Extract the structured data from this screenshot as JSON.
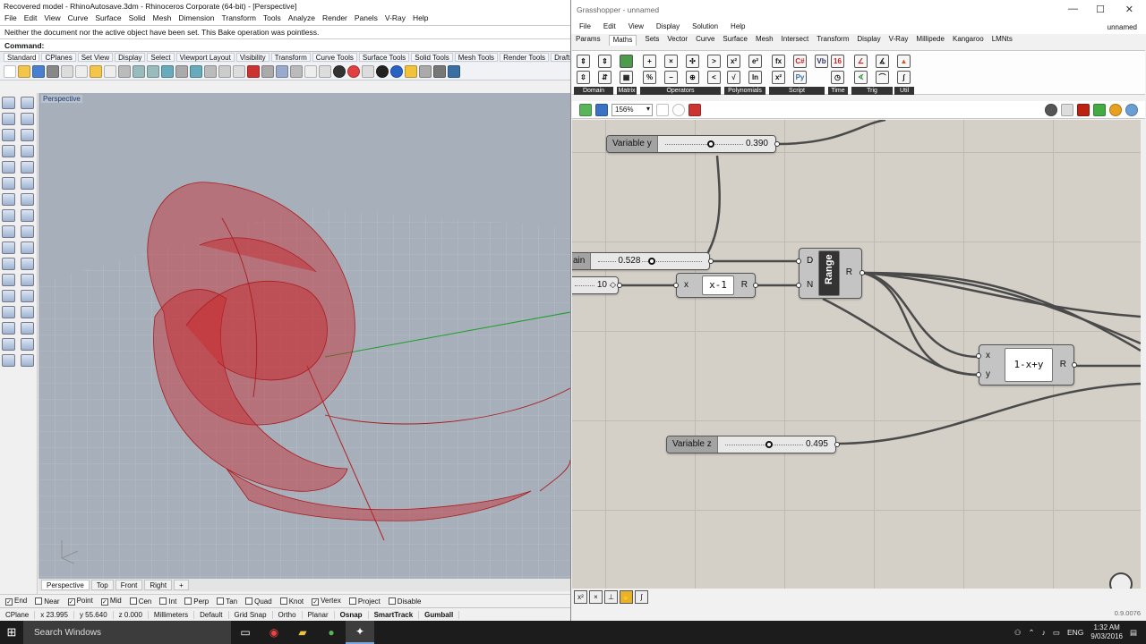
{
  "rhino": {
    "title": "Recovered model - RhinoAutosave.3dm - Rhinoceros Corporate (64-bit) - [Perspective]",
    "menu": [
      "File",
      "Edit",
      "View",
      "Curve",
      "Surface",
      "Solid",
      "Mesh",
      "Dimension",
      "Transform",
      "Tools",
      "Analyze",
      "Render",
      "Panels",
      "V-Ray",
      "Help"
    ],
    "command_history": "Neither the document nor the active object have been set. This Bake operation was pointless.",
    "command_prompt": "Command:",
    "toolbar_tabs": [
      "Standard",
      "CPlanes",
      "Set View",
      "Display",
      "Select",
      "Viewport Layout",
      "Visibility",
      "Transform",
      "Curve Tools",
      "Surface Tools",
      "Solid Tools",
      "Mesh Tools",
      "Render Tools",
      "Drafting"
    ],
    "viewport_label": "Perspective",
    "viewport_tabs": [
      "Perspective",
      "Top",
      "Front",
      "Right",
      "+"
    ],
    "osnaps": [
      {
        "label": "End",
        "checked": true
      },
      {
        "label": "Near",
        "checked": false
      },
      {
        "label": "Point",
        "checked": true
      },
      {
        "label": "Mid",
        "checked": true
      },
      {
        "label": "Cen",
        "checked": false
      },
      {
        "label": "Int",
        "checked": false
      },
      {
        "label": "Perp",
        "checked": false
      },
      {
        "label": "Tan",
        "checked": false
      },
      {
        "label": "Quad",
        "checked": false
      },
      {
        "label": "Knot",
        "checked": false
      },
      {
        "label": "Vertex",
        "checked": true
      },
      {
        "label": "Project",
        "checked": false
      },
      {
        "label": "Disable",
        "checked": false
      }
    ],
    "status": {
      "cplane": "CPlane",
      "x": "x 23.995",
      "y": "y 55.640",
      "z": "z 0.000",
      "units": "Millimeters",
      "layer": "Default",
      "grid_snap": "Grid Snap",
      "ortho": "Ortho",
      "planar": "Planar",
      "osnap": "Osnap",
      "smarttrack": "SmartTrack",
      "gumball": "Gumball"
    }
  },
  "gh": {
    "title": "Grasshopper - unnamed",
    "menu": [
      "File",
      "Edit",
      "View",
      "Display",
      "Solution",
      "Help"
    ],
    "doc_name": "unnamed",
    "tabs": [
      "Params",
      "Maths",
      "Sets",
      "Vector",
      "Curve",
      "Surface",
      "Mesh",
      "Intersect",
      "Transform",
      "Display",
      "V-Ray",
      "Millipede",
      "Kangaroo",
      "LMNts"
    ],
    "active_tab": "Maths",
    "groups": [
      "Domain",
      "Matrix",
      "Operators",
      "Polynomials",
      "Script",
      "Time",
      "Trig",
      "Util"
    ],
    "zoom": "156%",
    "version": "0.9.0076",
    "sliders": {
      "var_y": {
        "name": "Variable y",
        "value": "0.390",
        "fraction": 0.53
      },
      "main": {
        "name": "ain",
        "value": "0.528",
        "fraction": 0.5
      },
      "count": {
        "value": "10"
      },
      "var_z": {
        "name": "Variable z",
        "value": "0.495",
        "fraction": 0.5
      }
    },
    "expr1": {
      "input": "x",
      "core": "x-1",
      "output": "R"
    },
    "range": {
      "in_d": "D",
      "in_n": "N",
      "core": "Range",
      "output": "R"
    },
    "expr2": {
      "input_x": "x",
      "input_y": "y",
      "core": "1-x+y",
      "output": "R"
    }
  },
  "taskbar": {
    "search_placeholder": "Search Windows",
    "lang": "ENG",
    "time": "1:32 AM",
    "date": "9/03/2016"
  },
  "colors": {
    "surface_red": "#c0282c",
    "viewport_bg": "#a7b0ba",
    "canvas_bg": "#d4d0c8",
    "taskbar": "#1c1c1c"
  }
}
